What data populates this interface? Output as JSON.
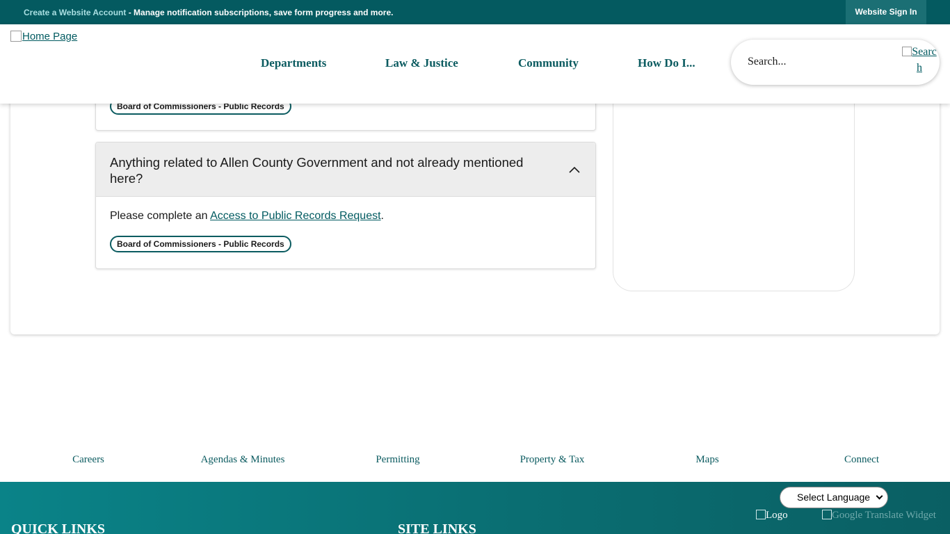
{
  "topbar": {
    "create_account_link": "Create a Website Account",
    "message": " - Manage notification subscriptions, save form progress and more.",
    "sign_in": "Website Sign In"
  },
  "header": {
    "logo_alt": "Home Page",
    "nav": [
      "Departments",
      "Law & Justice",
      "Community",
      "How Do I..."
    ],
    "search_placeholder": "Search...",
    "search_button_alt": "Search"
  },
  "faq": {
    "items": [
      {
        "tag": "Board of Commissioners - Public Records"
      },
      {
        "question": "Anything related to Allen County Government and not already mentioned here?",
        "answer_prefix": "Please complete an ",
        "answer_link": "Access to Public Records Request",
        "answer_suffix": ".",
        "tag": "Board of Commissioners - Public Records"
      }
    ]
  },
  "quick_nav": [
    "Careers",
    "Agendas & Minutes",
    "Permitting",
    "Property & Tax",
    "Maps",
    "Connect"
  ],
  "footer": {
    "quick_links_heading": "QUICK LINKS",
    "site_links_heading": "SITE LINKS",
    "language_select": "Select Language",
    "logo_alt": "Logo",
    "translate_alt": "Google Translate Widget"
  },
  "colors": {
    "brand_teal": "#045a60",
    "link": "#005a60",
    "footer_gradient_start": "#0a8388",
    "footer_gradient_end": "#0a5f63"
  }
}
